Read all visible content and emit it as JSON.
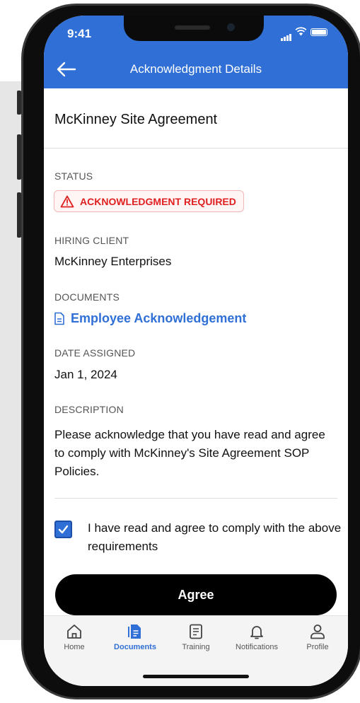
{
  "status_bar": {
    "time": "9:41"
  },
  "header": {
    "title": "Acknowledgment Details",
    "back_icon": "arrow-left-icon"
  },
  "document": {
    "title": "McKinney Site Agreement",
    "status_label": "STATUS",
    "status_badge": "ACKNOWLEDGMENT REQUIRED",
    "hiring_client_label": "HIRING CLIENT",
    "hiring_client": "McKinney Enterprises",
    "documents_label": "DOCUMENTS",
    "document_link": "Employee Acknowledgement",
    "date_assigned_label": "DATE ASSIGNED",
    "date_assigned": "Jan 1, 2024",
    "description_label": "DESCRIPTION",
    "description": "Please acknowledge that you have read and agree to comply with McKinney's Site Agreement SOP Policies."
  },
  "agreement": {
    "checkbox_label": "I have read and agree to comply with the above requirements",
    "checked": true,
    "agree_button": "Agree"
  },
  "tabs": [
    {
      "label": "Home",
      "icon": "home-icon",
      "active": false
    },
    {
      "label": "Documents",
      "icon": "document-icon",
      "active": true
    },
    {
      "label": "Training",
      "icon": "book-icon",
      "active": false
    },
    {
      "label": "Notifications",
      "icon": "bell-icon",
      "active": false
    },
    {
      "label": "Profile",
      "icon": "user-icon",
      "active": false
    }
  ],
  "colors": {
    "primary": "#2f6fd6",
    "danger": "#e02020",
    "button": "#000000"
  }
}
